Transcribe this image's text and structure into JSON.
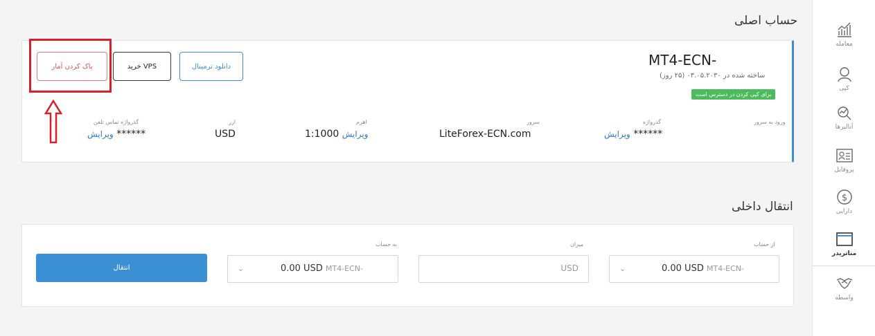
{
  "sidebar": {
    "items": [
      {
        "label": "معامله",
        "icon": "trade-chart-icon"
      },
      {
        "label": "کپی",
        "icon": "copy-person-icon"
      },
      {
        "label": "آنالیزها",
        "icon": "analysis-icon"
      },
      {
        "label": "پروفایل",
        "icon": "profile-card-icon"
      },
      {
        "label": "دارایی",
        "icon": "dollar-coin-icon"
      },
      {
        "label": "متاتریدر",
        "icon": "window-icon"
      },
      {
        "label": "واسطه",
        "icon": "handshake-icon"
      }
    ],
    "active_index": 5
  },
  "main_account": {
    "section_title": "حساب اصلی",
    "account_name": "MT4-ECN-",
    "created": "ساخته شده در ۰۳.۰۵.۲۰۳۰ (۲۵ روز)",
    "badge": "برای کپی کردن در دسترس است",
    "buttons": {
      "clear_stats": "پاک کردن آمار",
      "buy_vps": "خرید VPS",
      "download_terminal": "دانلود ترمینال"
    },
    "fields": {
      "server_login_label": "ورود به سرور",
      "password_label": "گذرواژه",
      "password_value": "******",
      "password_edit": "ویرایش",
      "server_label": "سرور",
      "server_value": "LiteForex-ECN.com",
      "leverage_label": "اهرم",
      "leverage_value": "1:1000",
      "leverage_edit": "ویرایش",
      "currency_label": "ارز",
      "currency_value": "USD",
      "phone_password_label": "گذرواژه تماس تلفن",
      "phone_password_value": "******",
      "phone_password_edit": "ویرایش"
    }
  },
  "transfer": {
    "section_title": "انتقال داخلی",
    "from_label": "از حساب",
    "from_account": "MT4-ECN-",
    "from_balance": "0.00 USD",
    "amount_label": "میزان",
    "amount_currency": "USD",
    "to_label": "به حساب",
    "to_account": "MT4-ECN-",
    "to_balance": "0.00 USD",
    "submit": "انتقال"
  },
  "colors": {
    "accent_blue": "#3a8fd5",
    "badge_green": "#4cbb5c",
    "highlight_red": "#d7202a"
  }
}
